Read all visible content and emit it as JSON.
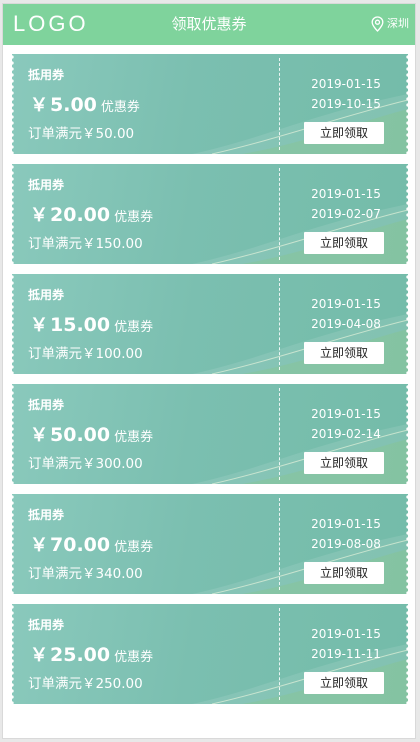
{
  "header": {
    "logo": "LOGO",
    "title": "领取优惠券",
    "city": "深圳",
    "location_icon": "location-pin-icon",
    "background_color": "#7fd39c"
  },
  "coupon_color": "#7bbfb0",
  "coupons": [
    {
      "type": "抵用券",
      "currency": "￥",
      "amount": "5.00",
      "unit": "优惠券",
      "condition": "订单满元￥50.00",
      "start_date": "2019-01-15",
      "end_date": "2019-10-15",
      "button": "立即领取"
    },
    {
      "type": "抵用券",
      "currency": "￥",
      "amount": "20.00",
      "unit": "优惠券",
      "condition": "订单满元￥150.00",
      "start_date": "2019-01-15",
      "end_date": "2019-02-07",
      "button": "立即领取"
    },
    {
      "type": "抵用券",
      "currency": "￥",
      "amount": "15.00",
      "unit": "优惠券",
      "condition": "订单满元￥100.00",
      "start_date": "2019-01-15",
      "end_date": "2019-04-08",
      "button": "立即领取"
    },
    {
      "type": "抵用券",
      "currency": "￥",
      "amount": "50.00",
      "unit": "优惠券",
      "condition": "订单满元￥300.00",
      "start_date": "2019-01-15",
      "end_date": "2019-02-14",
      "button": "立即领取"
    },
    {
      "type": "抵用券",
      "currency": "￥",
      "amount": "70.00",
      "unit": "优惠券",
      "condition": "订单满元￥340.00",
      "start_date": "2019-01-15",
      "end_date": "2019-08-08",
      "button": "立即领取"
    },
    {
      "type": "抵用券",
      "currency": "￥",
      "amount": "25.00",
      "unit": "优惠券",
      "condition": "订单满元￥250.00",
      "start_date": "2019-01-15",
      "end_date": "2019-11-11",
      "button": "立即领取"
    }
  ]
}
